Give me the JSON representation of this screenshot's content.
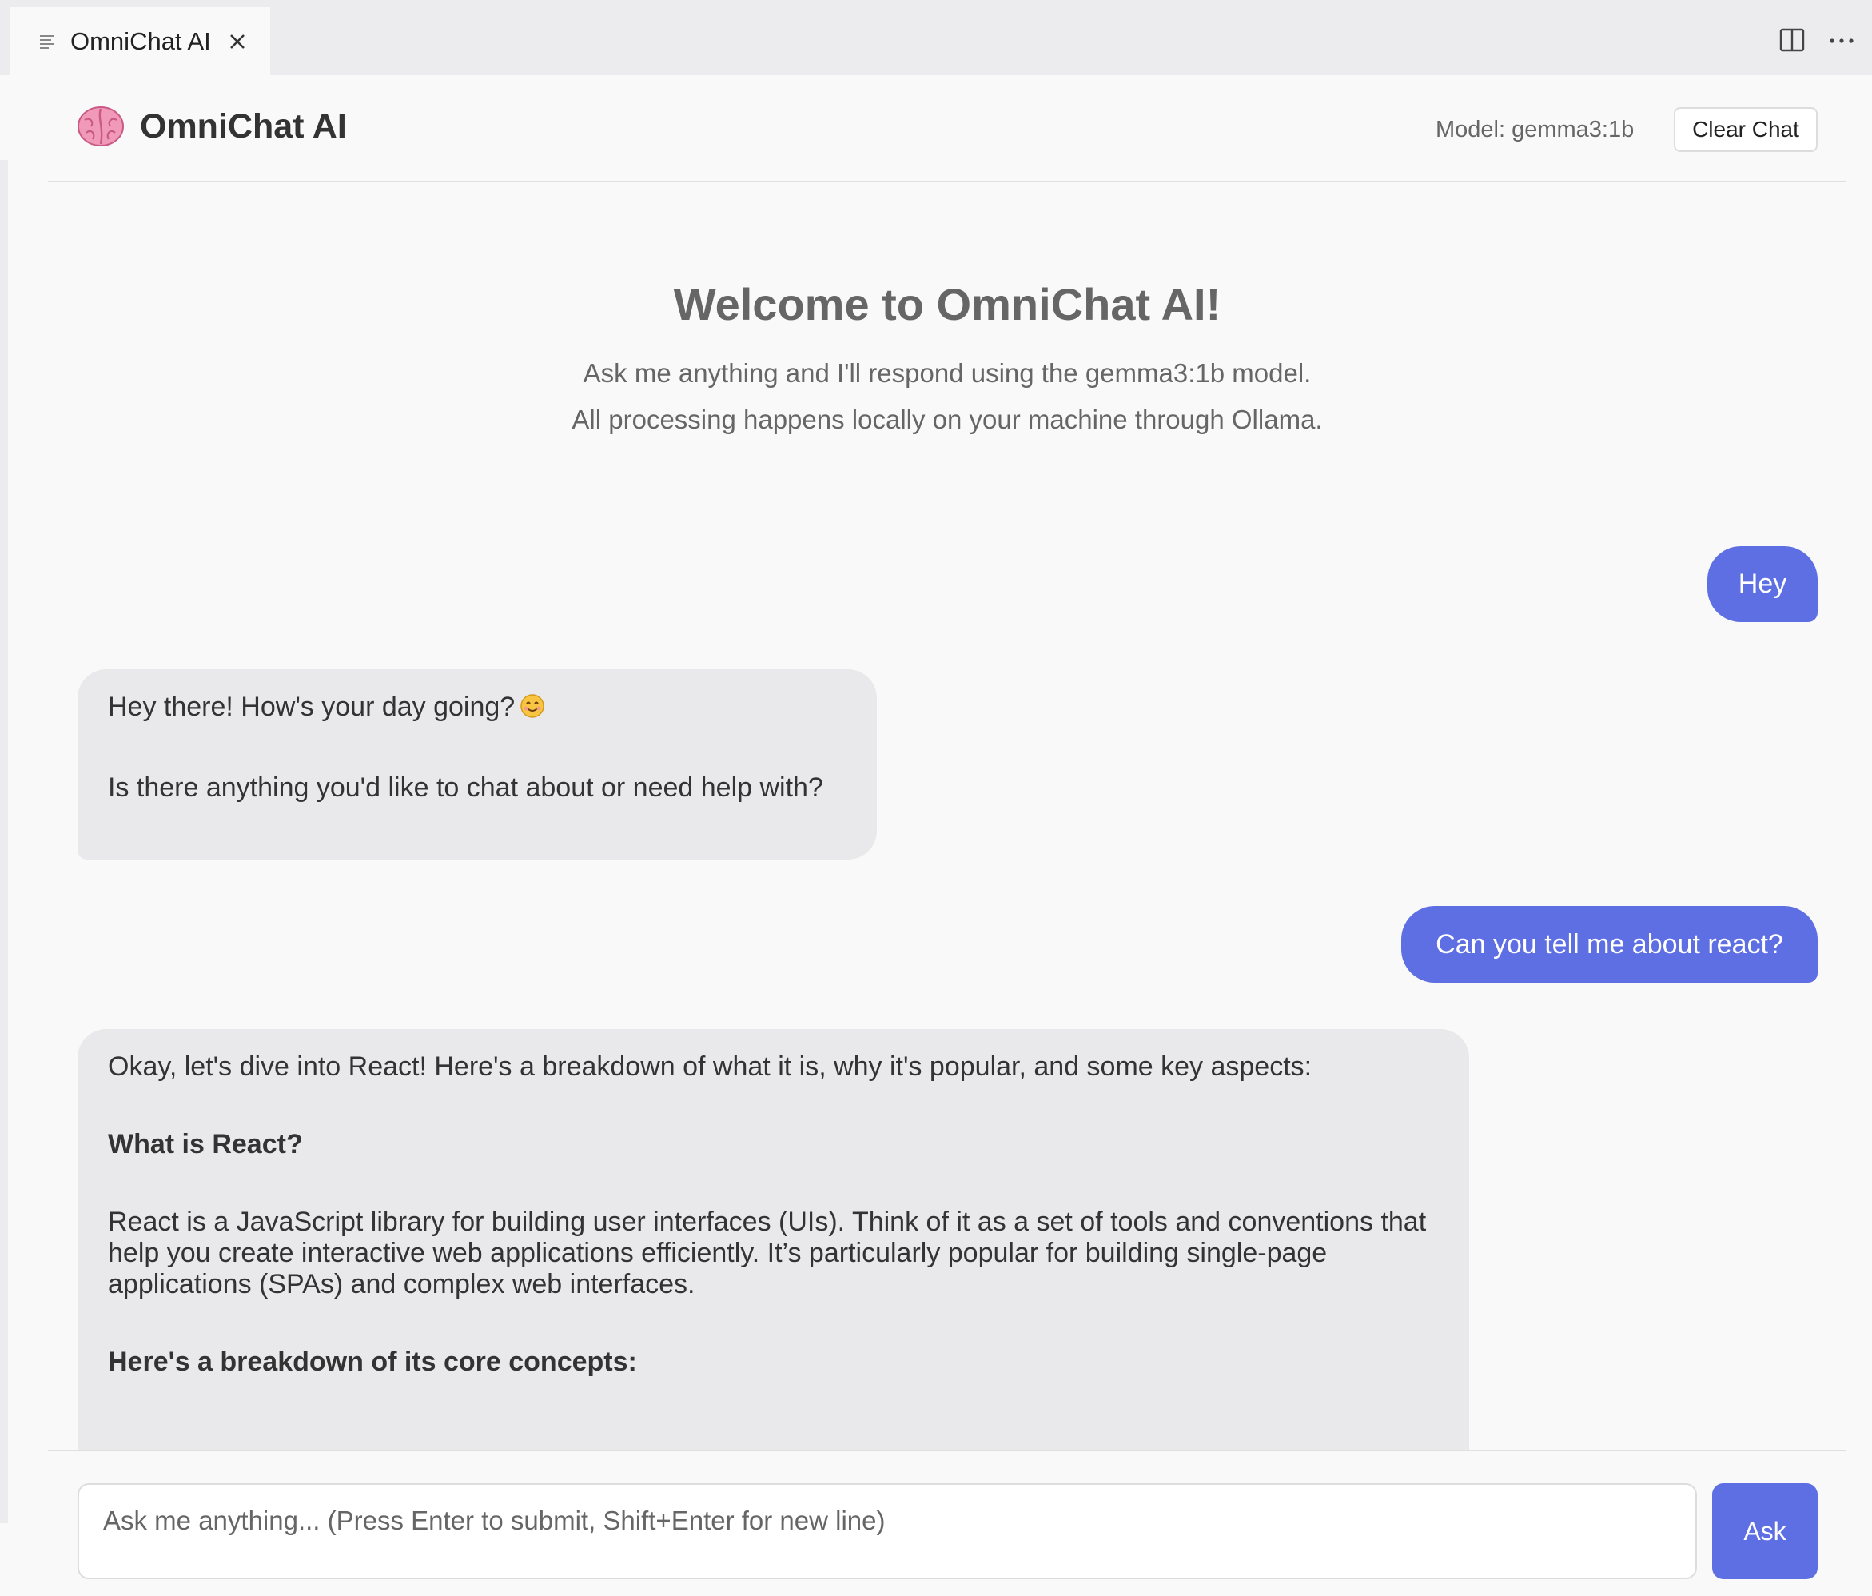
{
  "tab": {
    "label": "OmniChat AI"
  },
  "header": {
    "title": "OmniChat AI",
    "model_label": "Model: gemma3:1b",
    "clear_label": "Clear Chat"
  },
  "welcome": {
    "title": "Welcome to OmniChat AI!",
    "line1": "Ask me anything and I'll respond using the gemma3:1b model.",
    "line2": "All processing happens locally on your machine through Ollama."
  },
  "messages": [
    {
      "role": "user",
      "text": "Hey"
    },
    {
      "role": "assistant",
      "paragraphs": [
        "Hey there! How's your day going?",
        "Is there anything you'd like to chat about or need help with?"
      ]
    },
    {
      "role": "user",
      "text": "Can you tell me about react?"
    },
    {
      "role": "assistant",
      "paragraphs": [
        "Okay, let's dive into React! Here's a breakdown of what it is, why it's popular, and some key aspects:",
        "What is React?",
        "React is a JavaScript library for building user interfaces (UIs). Think of it as a set of tools and conventions that help you create interactive web applications efficiently. It’s particularly popular for building single-page applications (SPAs) and complex web interfaces.",
        "Here's a breakdown of its core concepts:"
      ]
    }
  ],
  "input": {
    "placeholder": "Ask me anything... (Press Enter to submit, Shift+Enter for new line)",
    "value": ""
  },
  "ask_label": "Ask",
  "colors": {
    "accent": "#5e6ee3",
    "assistant_bubble": "#e9e9eb",
    "background": "#f9f9f9"
  },
  "icons": {
    "tab": "preview-lines-icon",
    "close": "close-icon",
    "split": "split-editor-icon",
    "more": "more-actions-icon",
    "brand": "brain-icon",
    "emoji": "smiling-face-emoji"
  }
}
